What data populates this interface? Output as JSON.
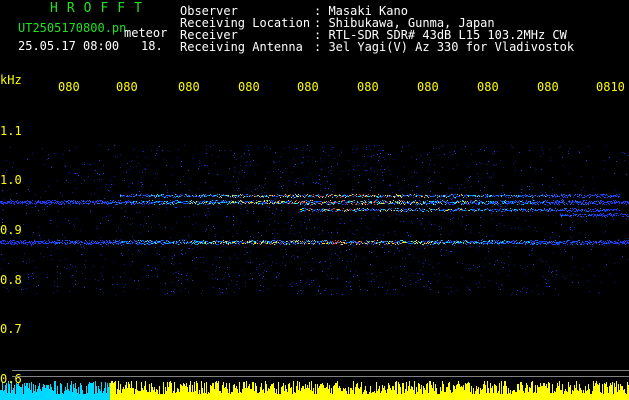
{
  "header": {
    "app_title": "HROFFT",
    "file_name": "UT2505170800.pn",
    "mode": "meteor",
    "timestamp": "25.05.17 08:00",
    "count": "18."
  },
  "info": [
    {
      "label": "Observer",
      "value": ": Masaki Kano"
    },
    {
      "label": "Receiving Location",
      "value": ": Shibukawa, Gunma, Japan"
    },
    {
      "label": "Receiver",
      "value": ": RTL-SDR SDR# 43dB L15 103.2MHz CW"
    },
    {
      "label": "Receiving Antenna",
      "value": ": 3el Yagi(V) Az 330 for Vladivostok"
    }
  ],
  "axis": {
    "unit": "kHz",
    "y_ticks": [
      "1.1",
      "1.0",
      "0.9",
      "0.8",
      "0.7",
      "0.6"
    ],
    "x_ticks": [
      "080",
      "080",
      "080",
      "080",
      "080",
      "080",
      "080",
      "080",
      "080",
      "0810"
    ]
  },
  "colors": {
    "label_green": "#21e021",
    "text_white": "#ffffff",
    "axis_yellow": "#ffff00",
    "signal_blue": "#1a3cff",
    "signal_cyan": "#00e5ff"
  }
}
